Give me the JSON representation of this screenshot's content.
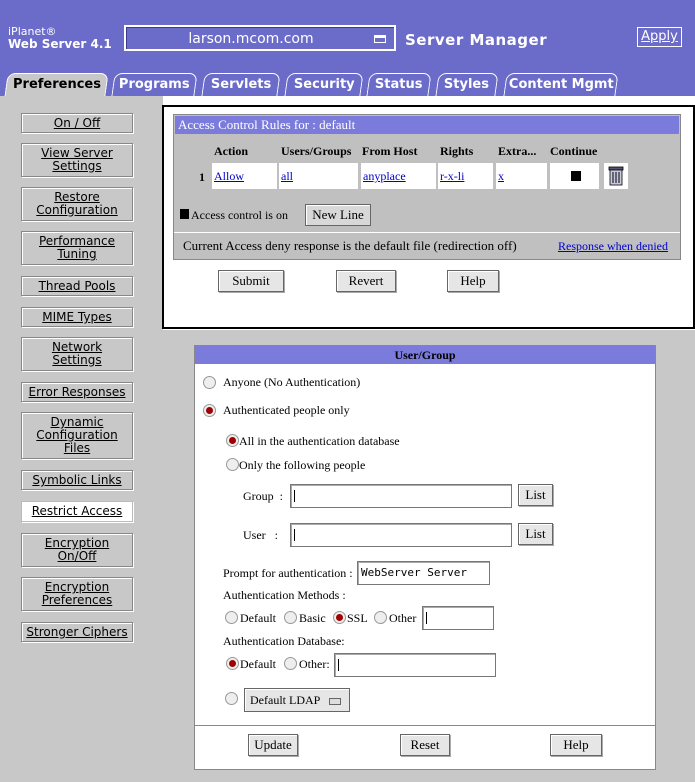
{
  "header": {
    "brand_small": "iPlanet®",
    "brand_big": "Web Server 4.1",
    "server_value": "larson.mcom.com",
    "manager_title": "Server Manager",
    "apply_label": "Apply",
    "colors": {
      "header_bg": "#6b6bc9",
      "sidebar_bg": "#c8c8c8",
      "title_bar": "#7b7bdc",
      "radio_selected": "#a00000"
    }
  },
  "tabs": [
    {
      "label": "Preferences",
      "active": true
    },
    {
      "label": "Programs"
    },
    {
      "label": "Servlets"
    },
    {
      "label": "Security"
    },
    {
      "label": "Status"
    },
    {
      "label": "Styles"
    },
    {
      "label": "Content Mgmt"
    }
  ],
  "sidebar": {
    "items": [
      {
        "label": "On / Off"
      },
      {
        "label": "View Server\nSettings"
      },
      {
        "label": "Restore\nConfiguration"
      },
      {
        "label": "Performance\nTuning"
      },
      {
        "label": "Thread Pools"
      },
      {
        "label": "MIME Types"
      },
      {
        "label": "Network\nSettings"
      },
      {
        "label": "Error Responses"
      },
      {
        "label": "Dynamic\nConfiguration\nFiles"
      },
      {
        "label": "Symbolic Links"
      },
      {
        "label": "Restrict Access",
        "active": true
      },
      {
        "label": "Encryption\nOn/Off"
      },
      {
        "label": "Encryption\nPreferences"
      },
      {
        "label": "Stronger Ciphers"
      }
    ]
  },
  "acl": {
    "title": "Access Control Rules for : default",
    "columns": [
      "Action",
      "Users/Groups",
      "From Host",
      "Rights",
      "Extra...",
      "Continue"
    ],
    "row": {
      "num": "1",
      "action": "Allow",
      "users": "all",
      "host": "anyplace",
      "rights": "r-x-li",
      "extra": "x"
    },
    "access_control_label": "Access control is on",
    "new_line_label": "New Line",
    "deny_text": "Current Access deny response is the default file (redirection off)",
    "deny_link": "Response when denied",
    "submit_label": "Submit",
    "revert_label": "Revert",
    "help_label": "Help",
    "trash_icon": "trash-icon"
  },
  "usergroup": {
    "title": "User/Group",
    "anyone_label": "Anyone (No Authentication)",
    "authenticated_label": "Authenticated people only",
    "all_db_label": "All in the authentication database",
    "only_following_label": "Only the following people",
    "group_label": "Group  :",
    "user_label": "User   :",
    "list_label": "List",
    "prompt_label": "Prompt for authentication :",
    "prompt_value": "WebServer Server",
    "auth_methods_label": "Authentication Methods :",
    "method_default": "Default",
    "method_basic": "Basic",
    "method_ssl": "SSL",
    "method_other": "Other",
    "auth_db_label": "Authentication Database:",
    "db_default": "Default",
    "db_other": "Other:",
    "ldap_value": "Default LDAP",
    "update_label": "Update",
    "reset_label": "Reset",
    "help_label": "Help"
  }
}
